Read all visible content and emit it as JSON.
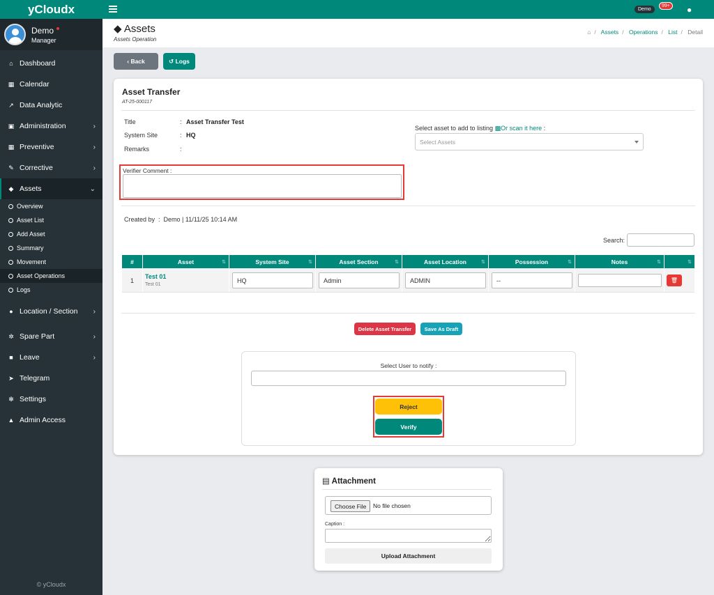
{
  "app": {
    "brand": "yCloudx"
  },
  "user": {
    "name": "Demo",
    "role": "Manager"
  },
  "sidebar": {
    "items": [
      {
        "label": "Dashboard",
        "icon": "home-icon"
      },
      {
        "label": "Calendar",
        "icon": "calendar-icon"
      },
      {
        "label": "Data Analytic",
        "icon": "chart-icon"
      },
      {
        "label": "Administration",
        "icon": "admin-icon"
      },
      {
        "label": "Preventive",
        "icon": "calendar-icon"
      },
      {
        "label": "Corrective",
        "icon": "wrench-icon"
      },
      {
        "label": "Assets",
        "icon": "tag-icon"
      }
    ],
    "sub_items": [
      {
        "label": "Overview"
      },
      {
        "label": "Asset List"
      },
      {
        "label": "Add Asset"
      },
      {
        "label": "Summary"
      },
      {
        "label": "Movement"
      },
      {
        "label": "Asset Operations"
      },
      {
        "label": "Logs"
      }
    ],
    "items2": [
      {
        "label": "Location / Section",
        "icon": "globe-icon"
      },
      {
        "label": "Spare Part",
        "icon": "gears-icon"
      },
      {
        "label": "Leave",
        "icon": "briefcase-icon"
      },
      {
        "label": "Telegram",
        "icon": "telegram-icon"
      },
      {
        "label": "Settings",
        "icon": "gear-icon"
      },
      {
        "label": "Admin Access",
        "icon": "lock-icon"
      }
    ],
    "footer": "© yCloudx"
  },
  "topbar": {
    "demo_badge": "Demo",
    "notif_count": "99+"
  },
  "header": {
    "title": "Assets",
    "subtitle": "Assets Operation",
    "breadcrumb": [
      "Assets",
      "Operations",
      "List",
      "Detail"
    ]
  },
  "actions": {
    "back": "Back",
    "logs": "Logs"
  },
  "card": {
    "title": "Asset Transfer",
    "code": "AT-25-000117",
    "fields": [
      {
        "label": "Title",
        "value": "Asset Transfer Test"
      },
      {
        "label": "System Site",
        "value": "HQ"
      },
      {
        "label": "Remarks",
        "value": ""
      }
    ],
    "select_asset_label": "Select asset to add to listing",
    "scan_link": "Or scan it here",
    "select_placeholder": "Select Assets",
    "verifier_label": "Verifier Comment :",
    "created_by_label": "Created by",
    "created_by_value": "Demo | 11/11/25 10:14 AM",
    "search_label": "Search:"
  },
  "table": {
    "headers": [
      "#",
      "Asset",
      "System Site",
      "Asset Section",
      "Asset Location",
      "Possession",
      "Notes",
      ""
    ],
    "rows": [
      {
        "num": "1",
        "asset": "Test 01",
        "asset_sub": "Test 01",
        "site": "HQ",
        "section": "Admin",
        "location": "ADMIN",
        "possession": "--",
        "notes": ""
      }
    ]
  },
  "footer_buttons": {
    "delete": "Delete Asset Transfer",
    "draft": "Save As Draft"
  },
  "notify": {
    "label": "Select User to notify :",
    "reject": "Reject",
    "verify": "Verify"
  },
  "attachment": {
    "title": "Attachment",
    "choose": "Choose File",
    "no_file": "No file chosen",
    "caption_label": "Caption :",
    "upload": "Upload Attachment"
  },
  "colors": {
    "brand": "#00897b",
    "sidebar": "#263238",
    "danger": "#e53935",
    "warning": "#ffc107",
    "info": "#17a2b8"
  }
}
